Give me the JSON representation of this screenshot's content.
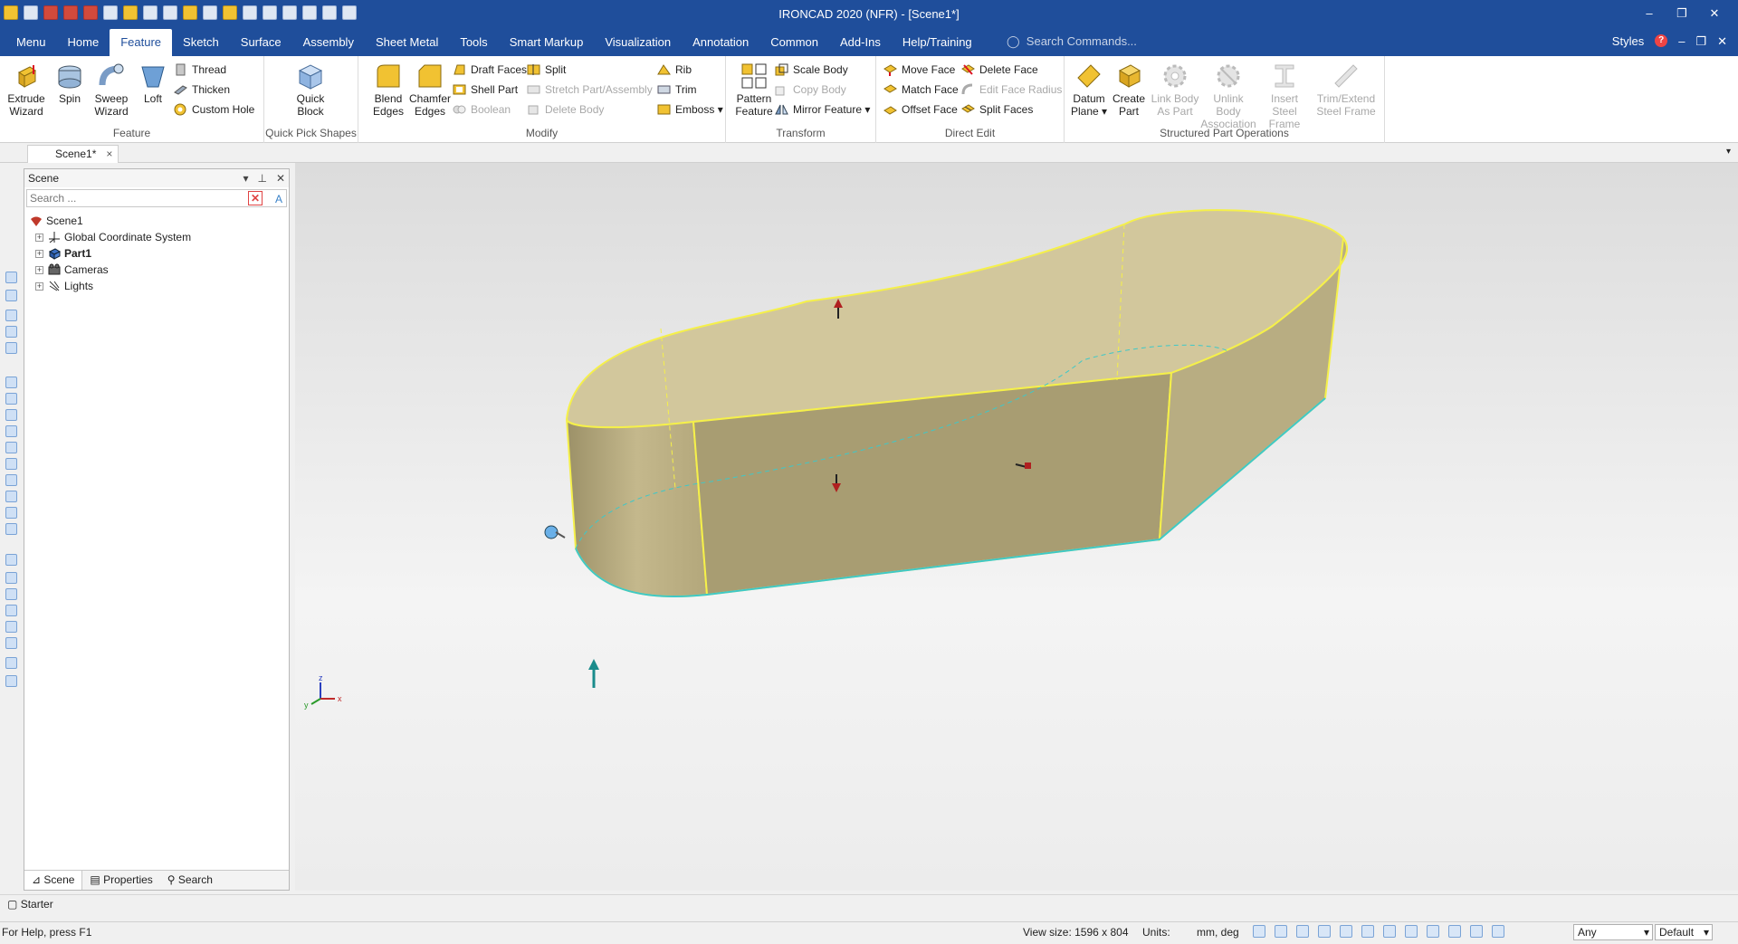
{
  "window": {
    "title": "IRONCAD 2020 (NFR) - [Scene1*]",
    "controls": [
      "–",
      "❐",
      "✕"
    ]
  },
  "menu": {
    "tabs": [
      "Menu",
      "Home",
      "Feature",
      "Sketch",
      "Surface",
      "Assembly",
      "Sheet Metal",
      "Tools",
      "Smart Markup",
      "Visualization",
      "Annotation",
      "Common",
      "Add-Ins",
      "Help/Training"
    ],
    "active_tab": "Feature",
    "search_placeholder": "Search Commands...",
    "styles_label": "Styles"
  },
  "ribbon": {
    "feature_group": {
      "label": "Feature",
      "extrude": "Extrude Wizard",
      "spin": "Spin",
      "sweep": "Sweep Wizard",
      "loft": "Loft",
      "thread": "Thread",
      "thicken": "Thicken",
      "custom_hole": "Custom Hole"
    },
    "quick_pick_group": {
      "label": "Quick Pick Shapes",
      "quick_block": "Quick Block"
    },
    "modify_group": {
      "label": "Modify",
      "blend_edges": "Blend Edges",
      "chamfer_edges": "Chamfer Edges",
      "draft_faces": "Draft Faces",
      "shell_part": "Shell Part",
      "boolean": "Boolean",
      "split": "Split",
      "stretch_part": "Stretch Part/Assembly",
      "delete_body": "Delete Body",
      "rib": "Rib",
      "trim": "Trim",
      "emboss": "Emboss"
    },
    "transform_group": {
      "label": "Transform",
      "pattern_feature": "Pattern Feature",
      "scale_body": "Scale Body",
      "copy_body": "Copy Body",
      "mirror_feature": "Mirror Feature"
    },
    "direct_edit_group": {
      "label": "Direct Edit",
      "move_face": "Move Face",
      "match_face": "Match Face",
      "offset_face": "Offset Face",
      "delete_face": "Delete Face",
      "edit_face_radius": "Edit Face Radius",
      "split_faces": "Split Faces"
    },
    "structured_group": {
      "label": "Structured Part Operations",
      "datum_plane": "Datum Plane",
      "create_part": "Create Part",
      "link_body": "Link Body As Part",
      "unlink_body": "Unlink Body Association",
      "insert_steel": "Insert Steel Frame",
      "trim_extend": "Trim/Extend Steel Frame"
    }
  },
  "document_tab": "Scene1*",
  "scene_panel": {
    "title": "Scene",
    "search_placeholder": "Search ...",
    "tree": [
      {
        "label": "Scene1",
        "bold": false,
        "indent": 0
      },
      {
        "label": "Global Coordinate System",
        "bold": false,
        "indent": 1
      },
      {
        "label": "Part1",
        "bold": true,
        "indent": 1
      },
      {
        "label": "Cameras",
        "bold": false,
        "indent": 1
      },
      {
        "label": "Lights",
        "bold": false,
        "indent": 1
      }
    ],
    "bottom_tabs": [
      "Scene",
      "Properties",
      "Search"
    ]
  },
  "axis_labels": {
    "z": "z",
    "x": "x",
    "y": "y"
  },
  "starter_label": "Starter",
  "status": {
    "help": "For Help, press F1",
    "view_size": "View size: 1596 x  804",
    "units_label": "Units:",
    "units_value": "mm, deg",
    "filter_value": "Any",
    "style_value": "Default"
  },
  "colors": {
    "title_blue": "#1f4e9b",
    "body_fill": "#c9bd8f",
    "edge_yellow": "#f5f04a",
    "edge_cyan": "#3ec8c8"
  }
}
